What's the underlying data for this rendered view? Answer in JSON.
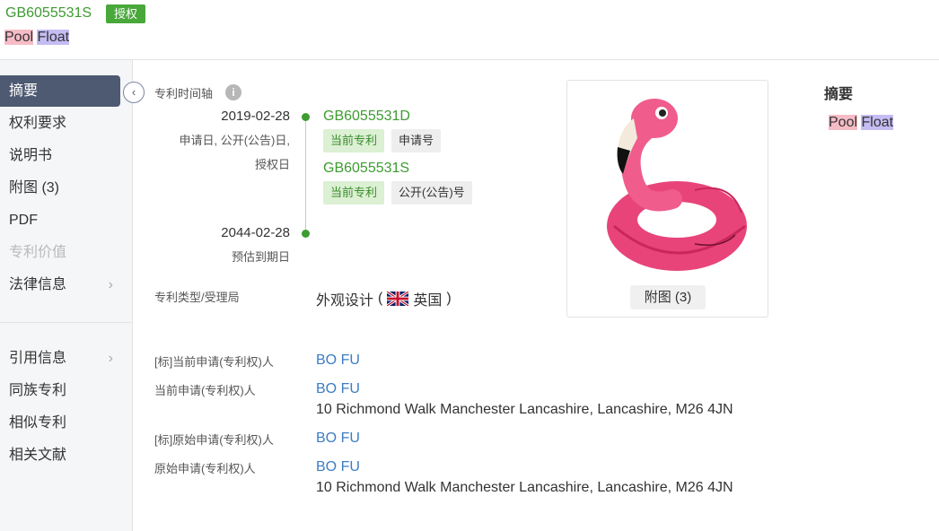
{
  "header": {
    "patent_number": "GB6055531S",
    "status_badge": "授权",
    "title_word1": "Pool",
    "title_word2": "Float"
  },
  "sidebar": {
    "items": [
      {
        "label": "摘要",
        "active": true
      },
      {
        "label": "权利要求"
      },
      {
        "label": "说明书"
      },
      {
        "label": "附图 (3)"
      },
      {
        "label": "PDF"
      },
      {
        "label": "专利价值",
        "disabled": true
      },
      {
        "label": "法律信息",
        "chevron": "›"
      },
      {
        "label": "引用信息",
        "chevron": "›"
      },
      {
        "label": "同族专利"
      },
      {
        "label": "相似专利"
      },
      {
        "label": "相关文献"
      }
    ],
    "collapse_icon": "‹"
  },
  "timeline": {
    "label": "专利时间轴",
    "info_icon": "i",
    "events": [
      {
        "date": "2019-02-28",
        "sublabel_line1": "申请日, 公开(公告)日,",
        "sublabel_line2": "授权日",
        "entries": [
          {
            "number": "GB6055531D",
            "tag_current": "当前专利",
            "tag_type": "申请号"
          },
          {
            "number": "GB6055531S",
            "tag_current": "当前专利",
            "tag_type": "公开(公告)号"
          }
        ]
      },
      {
        "date": "2044-02-28",
        "sublabel_line1": "预估到期日"
      }
    ]
  },
  "details": {
    "type_label": "专利类型/受理局",
    "type_value": "外观设计",
    "country": "英国",
    "rows": [
      {
        "label": "[标]当前申请(专利权)人",
        "name": "BO FU"
      },
      {
        "label": "当前申请(专利权)人",
        "name": "BO FU",
        "address": "10 Richmond Walk Manchester Lancashire, Lancashire, M26 4JN"
      },
      {
        "label": "[标]原始申请(专利权)人",
        "name": "BO FU"
      },
      {
        "label": "原始申请(专利权)人",
        "name": "BO FU",
        "address": "10 Richmond Walk Manchester Lancashire, Lancashire, M26 4JN"
      }
    ]
  },
  "figure": {
    "button_label": "附图 (3)"
  },
  "abstract": {
    "title": "摘要",
    "word1": "Pool",
    "word2": "Float"
  },
  "colors": {
    "accent_green": "#3d9b30",
    "link_blue": "#3d7dc2",
    "sidebar_active": "#4e5a72"
  }
}
